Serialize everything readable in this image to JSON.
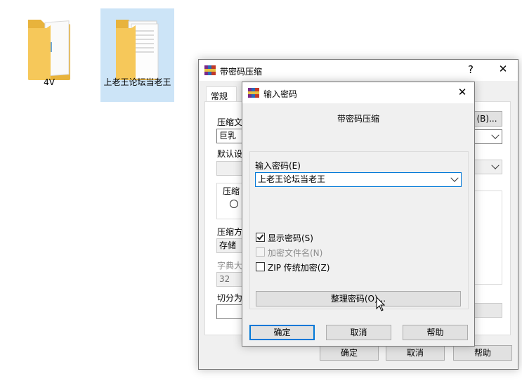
{
  "desktop": {
    "items": [
      {
        "label": "4V"
      },
      {
        "label": "上老王论坛当老王"
      }
    ]
  },
  "back_dialog": {
    "title": "带密码压缩",
    "help_glyph": "?",
    "close_glyph": "✕",
    "tab_general": "常规",
    "row_labels": [
      "压缩文",
      "巨乳",
      "默认设",
      "压缩",
      "压缩方",
      "存储",
      "字典大",
      "32",
      "切分为"
    ],
    "radio_label_fragment": "",
    "browse_button": "(B)...",
    "buttons": {
      "ok": "确定",
      "cancel": "取消",
      "help": "帮助"
    }
  },
  "password_dialog": {
    "title": "输入密码",
    "close_glyph": "✕",
    "heading": "带密码压缩",
    "password_label": "输入密码(E)",
    "password_value": "上老王论坛当老王",
    "options": [
      {
        "label": "显示密码(S)",
        "checked": true,
        "disabled": false
      },
      {
        "label": "加密文件名(N)",
        "checked": false,
        "disabled": true
      },
      {
        "label": "ZIP 传统加密(Z)",
        "checked": false,
        "disabled": false
      }
    ],
    "organize_button": "整理密码(O)...",
    "buttons": {
      "ok": "确定",
      "cancel": "取消",
      "help": "帮助"
    }
  },
  "colors": {
    "accent": "#0078d7",
    "selection": "#cce4f7",
    "folder": "#f6c85a"
  }
}
